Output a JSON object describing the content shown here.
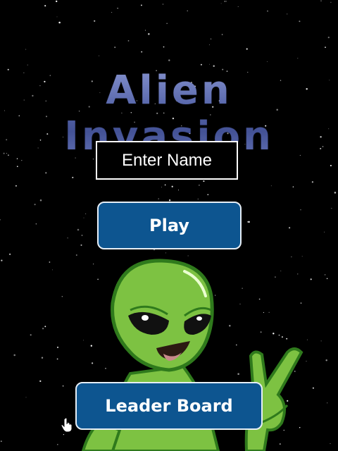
{
  "game": {
    "title": "Alien Invasion",
    "name_placeholder": "Enter Name",
    "play_label": "Play",
    "leaderboard_label": "Leader Board"
  },
  "colors": {
    "background": "#000000",
    "button": "#0d5590",
    "alien_green": "#7dc242"
  },
  "icons": {
    "cursor": "hand-cursor-icon",
    "mascot": "alien-peace-sign"
  }
}
